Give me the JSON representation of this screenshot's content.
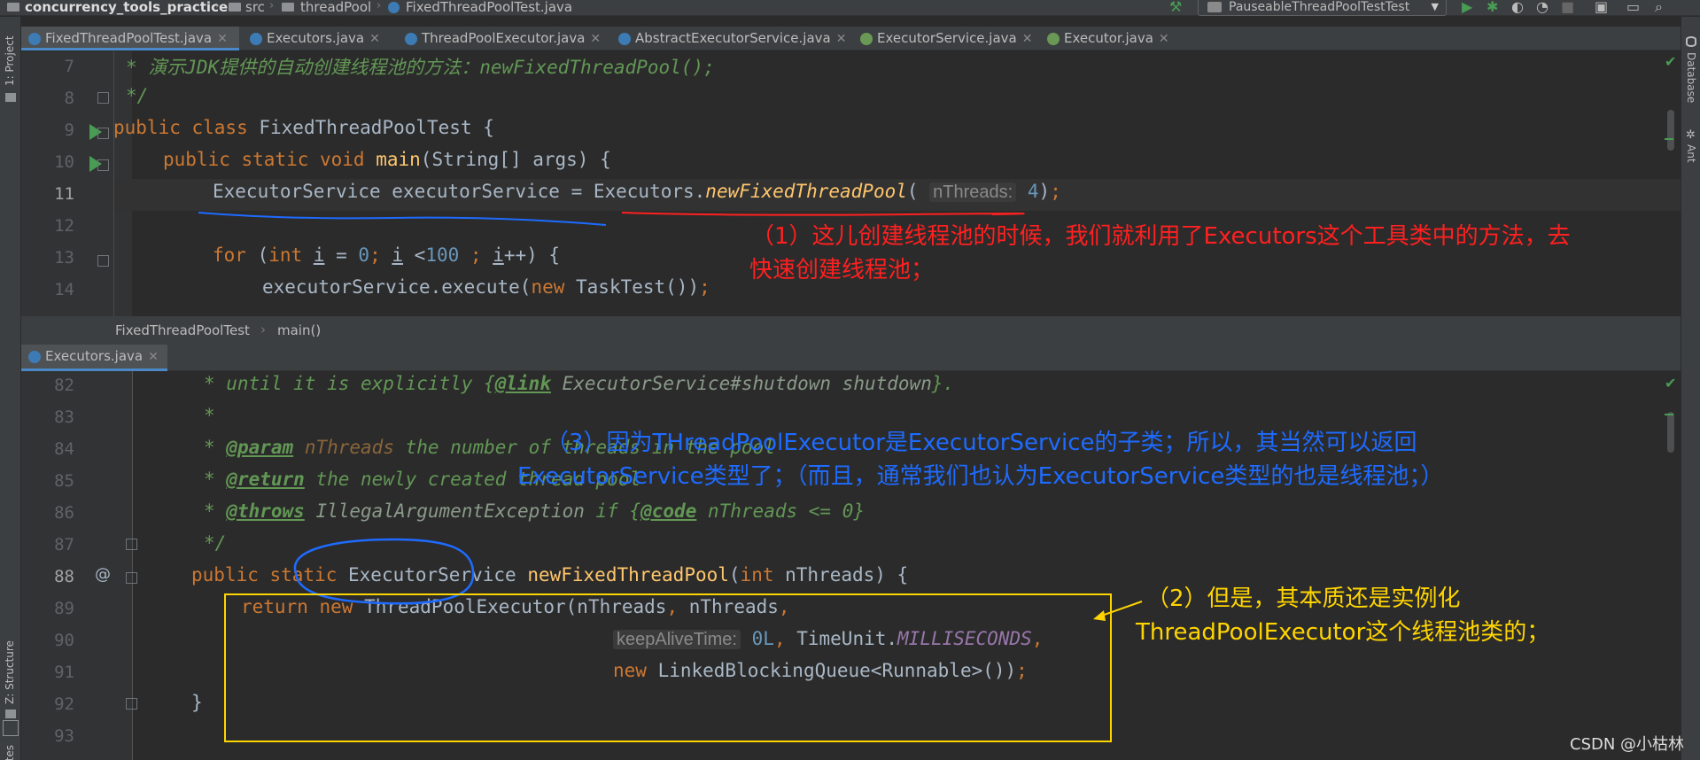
{
  "navbar": {
    "project": "concurrency_tools_practice",
    "src": "src",
    "package": "threadPool",
    "file": "FixedThreadPoolTest.java",
    "run_config": "PauseableThreadPoolTestTest"
  },
  "left_strip": {
    "project_label": "1: Project",
    "structure_label": "Z: Structure",
    "favorites_label": "orites"
  },
  "right_strip": {
    "database_label": "Database",
    "ant_label": "Ant"
  },
  "top_tabs": [
    {
      "label": "FixedThreadPoolTest.java",
      "active": true,
      "icon": "class-icon"
    },
    {
      "label": "Executors.java",
      "active": false,
      "icon": "class-icon"
    },
    {
      "label": "ThreadPoolExecutor.java",
      "active": false,
      "icon": "class-icon"
    },
    {
      "label": "AbstractExecutorService.java",
      "active": false,
      "icon": "class-icon"
    },
    {
      "label": "ExecutorService.java",
      "active": false,
      "icon": "interface-icon"
    },
    {
      "label": "Executor.java",
      "active": false,
      "icon": "interface-icon"
    }
  ],
  "top_editor": {
    "line_numbers": [
      "7",
      "8",
      "9",
      "10",
      "11",
      "12",
      "13",
      "14"
    ],
    "lines": [
      "* 演示JDK提供的自动创建线程池的方法：newFixedThreadPool();",
      "*/",
      "public class FixedThreadPoolTest {",
      "public static void main(String[] args) {",
      "ExecutorService executorService = Executors.newFixedThreadPool( nThreads: 4);",
      "",
      "for (int i = 0; i <100 ; i++) {",
      "executorService.execute(new TaskTest());"
    ]
  },
  "breadcrumb": {
    "class": "FixedThreadPoolTest",
    "method": "main()"
  },
  "bottom_tab": {
    "label": "Executors.java"
  },
  "bottom_editor": {
    "line_numbers": [
      "82",
      "83",
      "84",
      "85",
      "86",
      "87",
      "88",
      "89",
      "90",
      "91",
      "92",
      "93"
    ],
    "lines": [
      "* until it is explicitly {@link ExecutorService#shutdown shutdown}.",
      "*",
      "* @param nThreads the number of threads in the pool",
      "* @return the newly created thread pool",
      "* @throws IllegalArgumentException if {@code nThreads <= 0}",
      "*/",
      "public static ExecutorService newFixedThreadPool(int nThreads) {",
      "return new ThreadPoolExecutor(nThreads, nThreads,",
      "keepAliveTime: 0L, TimeUnit.MILLISECONDS,",
      "new LinkedBlockingQueue<Runnable>());",
      "}",
      ""
    ]
  },
  "annotations": {
    "note1_line1": "（1）这儿创建线程池的时候，我们就利用了Executors这个工具类中的方法，去",
    "note1_line2": "快速创建线程池；",
    "note2_line1": "（2）但是，其本质还是实例化",
    "note2_line2": "ThreadPoolExecutor这个线程池类的；",
    "note3_line1": "（3）因为THreadPoolExecutor是ExecutorService的子类；所以，其当然可以返回",
    "note3_line2": "ExecutorService类型了；（而且，通常我们也认为ExecutorService类型的也是线程池；）"
  },
  "watermark": "CSDN @小枯林",
  "colors": {
    "annotation_red": "#ff2020",
    "annotation_blue": "#1e6bff",
    "annotation_yellow": "#ffd500",
    "keyword": "#cc7832",
    "number": "#6897bb",
    "comment": "#629755"
  }
}
